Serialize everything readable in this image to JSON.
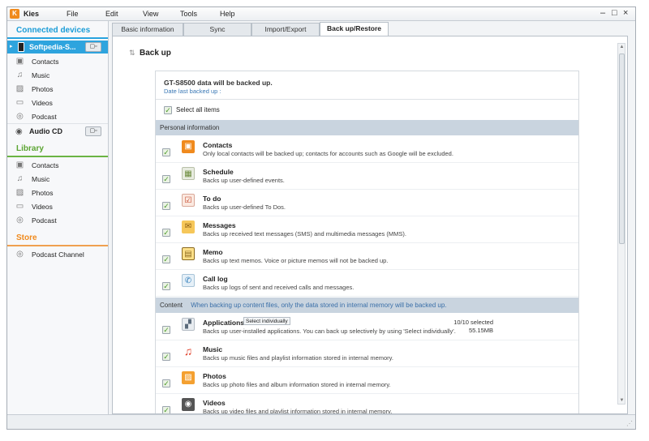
{
  "app": {
    "logo_text": "K",
    "title": "Kies"
  },
  "menu": [
    "File",
    "Edit",
    "View",
    "Tools",
    "Help"
  ],
  "window_controls": {
    "minimize": "‒",
    "maximize": "□",
    "close": "×"
  },
  "sidebar": {
    "connected_devices": {
      "heading": "Connected devices",
      "device": {
        "name": "Softpedia-S...",
        "button": "▢▫"
      },
      "device_items": [
        {
          "label": "Contacts",
          "icon": "contacts-icon"
        },
        {
          "label": "Music",
          "icon": "music-icon"
        },
        {
          "label": "Photos",
          "icon": "photos-icon"
        },
        {
          "label": "Videos",
          "icon": "videos-icon"
        },
        {
          "label": "Podcast",
          "icon": "podcast-icon"
        }
      ],
      "audio_cd": {
        "name": "Audio CD",
        "button": "▢▫"
      }
    },
    "library": {
      "heading": "Library",
      "items": [
        {
          "label": "Contacts",
          "icon": "contacts-icon"
        },
        {
          "label": "Music",
          "icon": "music-icon"
        },
        {
          "label": "Photos",
          "icon": "photos-icon"
        },
        {
          "label": "Videos",
          "icon": "videos-icon"
        },
        {
          "label": "Podcast",
          "icon": "podcast-icon"
        }
      ]
    },
    "store": {
      "heading": "Store",
      "items": [
        {
          "label": "Podcast Channel",
          "icon": "podcast-icon"
        }
      ]
    }
  },
  "tabs": [
    {
      "label": "Basic information",
      "active": false
    },
    {
      "label": "Sync",
      "active": false
    },
    {
      "label": "Import/Export",
      "active": false
    },
    {
      "label": "Back up/Restore",
      "active": true
    }
  ],
  "backup": {
    "title": "Back up",
    "panel": {
      "title": "GT-S8500  data will be backed up.",
      "subtitle": "Date last backed up :",
      "select_all": "Select all items"
    },
    "personal": {
      "heading": "Personal information",
      "items": [
        {
          "title": "Contacts",
          "desc": "Only local contacts will be backed up; contacts for accounts such as Google will be excluded.",
          "icon": "contacts-icon",
          "checked": true
        },
        {
          "title": "Schedule",
          "desc": "Backs up user-defined events.",
          "icon": "calendar-icon",
          "checked": true
        },
        {
          "title": "To do",
          "desc": "Backs up user-defined To Dos.",
          "icon": "todo-icon",
          "checked": true
        },
        {
          "title": "Messages",
          "desc": "Backs up received text messages (SMS) and multimedia messages (MMS).",
          "icon": "envelope-icon",
          "checked": true
        },
        {
          "title": "Memo",
          "desc": "Backs up text memos. Voice or picture memos will not be backed up.",
          "icon": "memo-icon",
          "checked": true
        },
        {
          "title": "Call log",
          "desc": "Backs up logs of sent and received calls and messages.",
          "icon": "call-log-icon",
          "checked": true
        }
      ]
    },
    "content": {
      "heading": "Content",
      "note": "When backing up content files, only the data stored in internal memory will be backed up.",
      "items": [
        {
          "title": "Applications",
          "desc": "Backs up user-installed applications. You can back up selectively by using 'Select individually'.",
          "icon": "applications-icon",
          "checked": true,
          "button": "Select individually",
          "selected": "10/10 selected",
          "size": "55.15MB"
        },
        {
          "title": "Music",
          "desc": "Backs up music files and playlist information stored in internal memory.",
          "icon": "music-icon",
          "checked": true
        },
        {
          "title": "Photos",
          "desc": "Backs up photo files and album information stored in internal memory.",
          "icon": "photos-icon",
          "checked": true
        },
        {
          "title": "Videos",
          "desc": "Backs up video files and playlist information stored in internal memory.",
          "icon": "videos-icon",
          "checked": true
        }
      ]
    }
  },
  "colors": {
    "accent_blue": "#28a3df",
    "library_green": "#6bb443",
    "store_orange": "#f08a1d",
    "group_bar": "#c9d4df"
  }
}
